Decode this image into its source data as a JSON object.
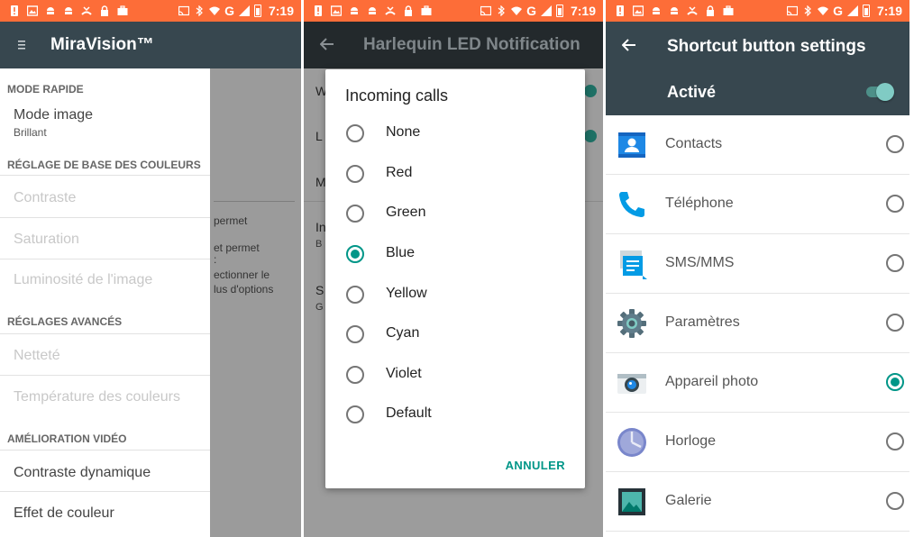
{
  "statusbar": {
    "time": "7:19",
    "network": "G"
  },
  "screen1": {
    "title": "MiraVision™",
    "categories": [
      "MODE RAPIDE",
      "RÉGLAGE DE BASE DES COULEURS",
      "RÉGLAGES AVANCÉS",
      "AMÉLIORATION VIDÉO"
    ],
    "mode_image": {
      "label": "Mode image",
      "value": "Brillant"
    },
    "basic_items": [
      "Contraste",
      "Saturation",
      "Luminosité de l'image"
    ],
    "advanced_items": [
      "Netteté",
      "Température des couleurs"
    ],
    "video_items": [
      "Contraste dynamique",
      "Effet de couleur"
    ],
    "background_fragments": [
      "permet",
      "et permet",
      ":",
      "ectionner le",
      "lus d'options"
    ]
  },
  "screen2": {
    "title": "Harlequin LED Notification",
    "peek_letters": [
      "W",
      "L",
      "M",
      "In",
      "B",
      "S",
      "G"
    ],
    "dialog": {
      "title": "Incoming calls",
      "options": [
        "None",
        "Red",
        "Green",
        "Blue",
        "Yellow",
        "Cyan",
        "Violet",
        "Default"
      ],
      "selected": "Blue",
      "cancel_label": "ANNULER"
    }
  },
  "screen3": {
    "title": "Shortcut button settings",
    "switch_label": "Activé",
    "switch_on": true,
    "apps": [
      {
        "label": "Contacts",
        "icon": "contacts-icon",
        "selected": false
      },
      {
        "label": "Téléphone",
        "icon": "phone-icon",
        "selected": false
      },
      {
        "label": "SMS/MMS",
        "icon": "messaging-icon",
        "selected": false
      },
      {
        "label": "Paramètres",
        "icon": "settings-gear-icon",
        "selected": false
      },
      {
        "label": "Appareil photo",
        "icon": "camera-icon",
        "selected": true
      },
      {
        "label": "Horloge",
        "icon": "clock-icon",
        "selected": false
      },
      {
        "label": "Galerie",
        "icon": "gallery-icon",
        "selected": false
      }
    ]
  },
  "colors": {
    "statusbar": "#fd6d38",
    "toolbar": "#37474f",
    "accent": "#009688"
  }
}
